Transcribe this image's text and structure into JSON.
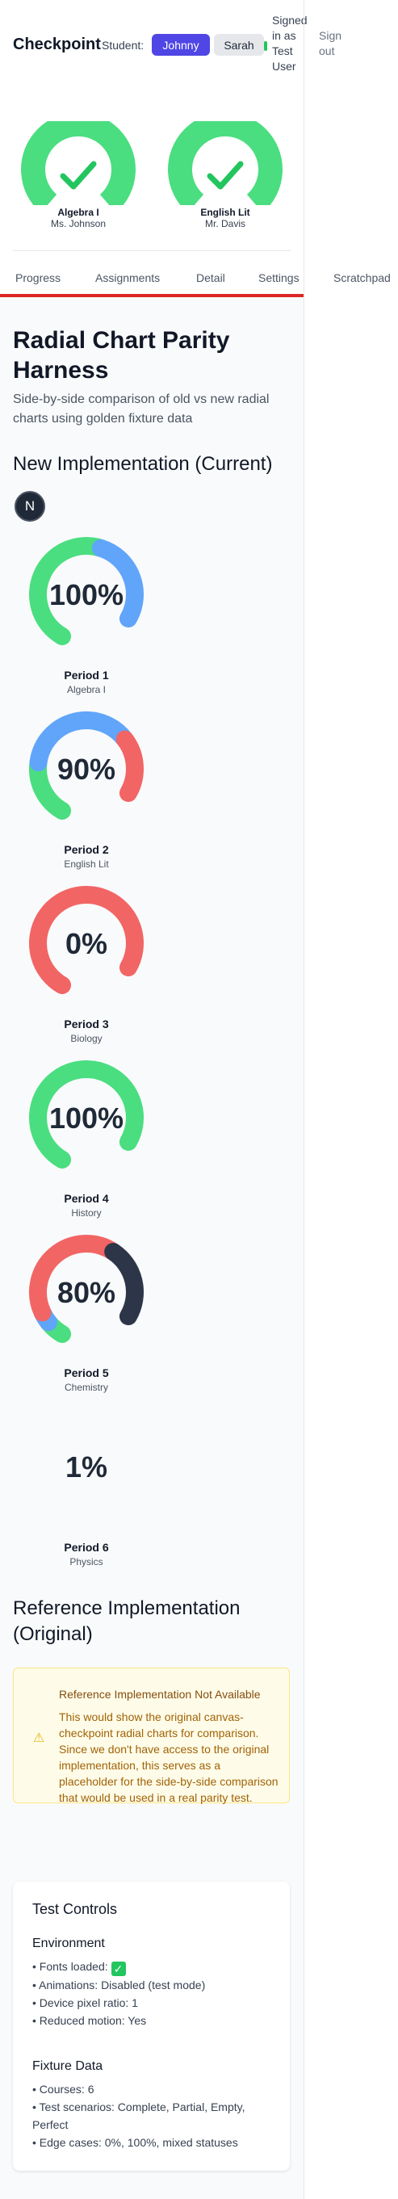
{
  "header": {
    "brand": "Checkpoint",
    "student_label": "Student:",
    "students": [
      "Johnny",
      "Sarah"
    ],
    "signed_in": "Signed in as Test User",
    "sign_out": "Sign out"
  },
  "overview": [
    {
      "name": "Algebra I",
      "teacher": "Ms. Johnson",
      "icon": "check-icon"
    },
    {
      "name": "English Lit",
      "teacher": "Mr. Davis",
      "icon": "check-icon"
    }
  ],
  "tabs": [
    "Progress",
    "Assignments",
    "Detail",
    "Settings",
    "Scratchpad"
  ],
  "page": {
    "title": "Radial Chart Parity Harness",
    "subtitle": "Side-by-side comparison of old vs new radial charts using golden fixture data",
    "new_heading": "New Implementation (Current)",
    "badge": "N",
    "ref_heading": "Reference Implementation (Original)"
  },
  "colors": {
    "complete": "#4ade80",
    "partial": "#60a5fa",
    "missing": "#f26565",
    "late": "#2d3648",
    "accent": "#4f46e5"
  },
  "radials": [
    {
      "percent": "100%",
      "name": "Period 1",
      "subject": "Algebra I",
      "segments": [
        {
          "status": "complete",
          "fraction": 0.62
        },
        {
          "status": "partial",
          "fraction": 0.38
        }
      ]
    },
    {
      "percent": "90%",
      "name": "Period 2",
      "subject": "English Lit",
      "segments": [
        {
          "status": "complete",
          "fraction": 0.25
        },
        {
          "status": "partial",
          "fraction": 0.5
        },
        {
          "status": "missing",
          "fraction": 0.25
        }
      ]
    },
    {
      "percent": "0%",
      "name": "Period 3",
      "subject": "Biology",
      "segments": [
        {
          "status": "missing",
          "fraction": 1.0
        }
      ]
    },
    {
      "percent": "100%",
      "name": "Period 4",
      "subject": "History",
      "segments": [
        {
          "status": "complete",
          "fraction": 1.0
        }
      ]
    },
    {
      "percent": "80%",
      "name": "Period 5",
      "subject": "Chemistry",
      "segments": [
        {
          "status": "complete",
          "fraction": 0.08
        },
        {
          "status": "partial",
          "fraction": 0.05
        },
        {
          "status": "missing",
          "fraction": 0.55
        },
        {
          "status": "late",
          "fraction": 0.32
        }
      ]
    },
    {
      "percent": "1%",
      "name": "Period 6",
      "subject": "Physics",
      "segments": []
    }
  ],
  "warning": {
    "icon": "warning-icon",
    "title": "Reference Implementation Not Available",
    "body": "This would show the original canvas-checkpoint radial charts for comparison. Since we don't have access to the original implementation, this serves as a placeholder for the side-by-side comparison that would be used in a real parity test."
  },
  "controls": {
    "title": "Test Controls",
    "env_heading": "Environment",
    "env": [
      "Fonts loaded:",
      "Animations: Disabled (test mode)",
      "Device pixel ratio: 1",
      "Reduced motion: Yes"
    ],
    "fonts_check": "✓",
    "fixture_heading": "Fixture Data",
    "fixture": [
      "Courses: 6",
      "Test scenarios: Complete, Partial, Empty, Perfect",
      "Edge cases: 0%, 100%, mixed statuses"
    ]
  }
}
